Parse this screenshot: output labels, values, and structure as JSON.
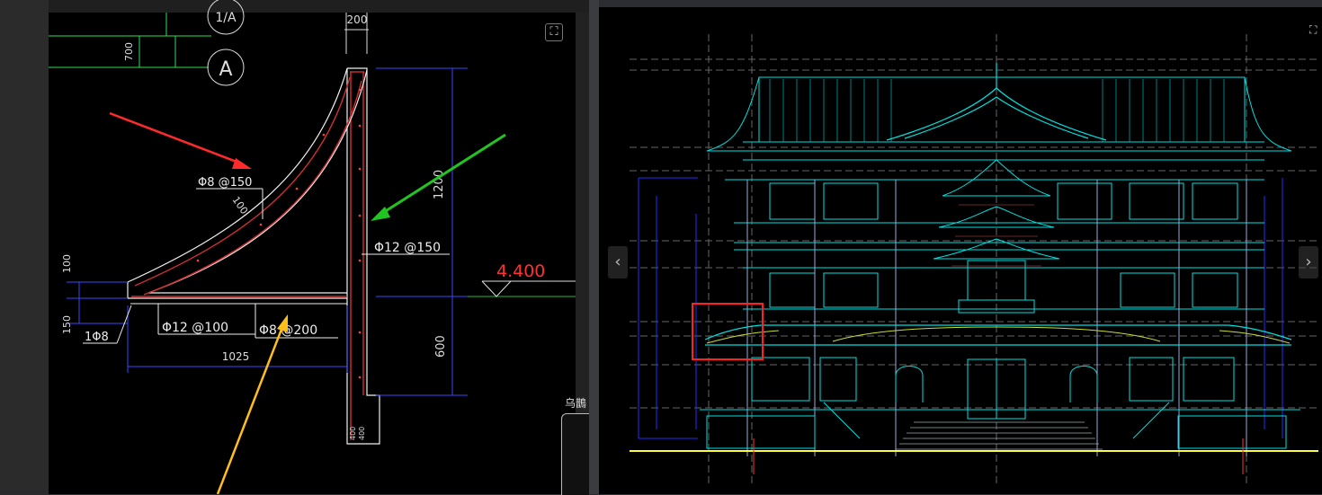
{
  "left_drawing": {
    "axis_labels": [
      "1/A",
      "A"
    ],
    "dimensions": {
      "top_width": "200",
      "left_700": "700",
      "height_1200": "1200",
      "height_600": "600",
      "height_100": "100",
      "height_150": "150",
      "width_1025": "1025",
      "slab_thickness": "100",
      "wall_bottom_a": "400",
      "wall_bottom_b": "400"
    },
    "rebar_labels": {
      "curve_rebar": "Φ8 @150",
      "wall_rebar": "Φ12 @150",
      "slab_rebar_main": "Φ12 @100",
      "slab_rebar_dist": "Φ8 @200",
      "edge_rebar": "1Φ8"
    },
    "elevation": "4.400"
  },
  "side_widget": {
    "label": "乌鵲"
  },
  "controls": {
    "fullscreen_icon": "⛶",
    "prev_glyph": "‹",
    "next_glyph": "›"
  },
  "colors": {
    "arrow_red": "#ff2a2a",
    "arrow_green": "#22c422",
    "arrow_yellow": "#ffbf1a",
    "elevation_red": "#ff3030",
    "cad_cyan": "#00e0e0",
    "cad_blue": "#2030ff",
    "highlight_red": "#ff2020"
  }
}
